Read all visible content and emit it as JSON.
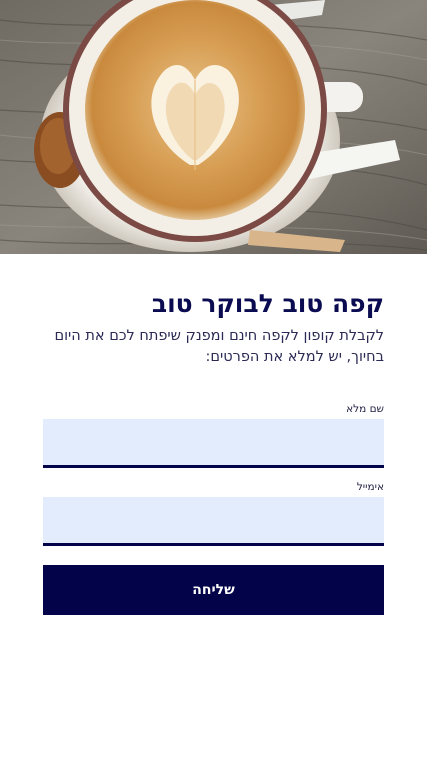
{
  "hero": {
    "image_name": "latte-art-coffee-cup-photo"
  },
  "form": {
    "title": "קפה טוב לבוקר טוב",
    "subtitle": "לקבלת קופון לקפה חינם ומפנק שיפתח לכם את היום בחיוך, יש למלא את הפרטים:",
    "fields": [
      {
        "label": "שם מלא",
        "value": "",
        "placeholder": ""
      },
      {
        "label": "אימייל",
        "value": "",
        "placeholder": ""
      }
    ],
    "submit_label": "שליחה"
  },
  "colors": {
    "primary": "#03034a",
    "title": "#0b0b52",
    "input_background": "#e3ecfd"
  }
}
